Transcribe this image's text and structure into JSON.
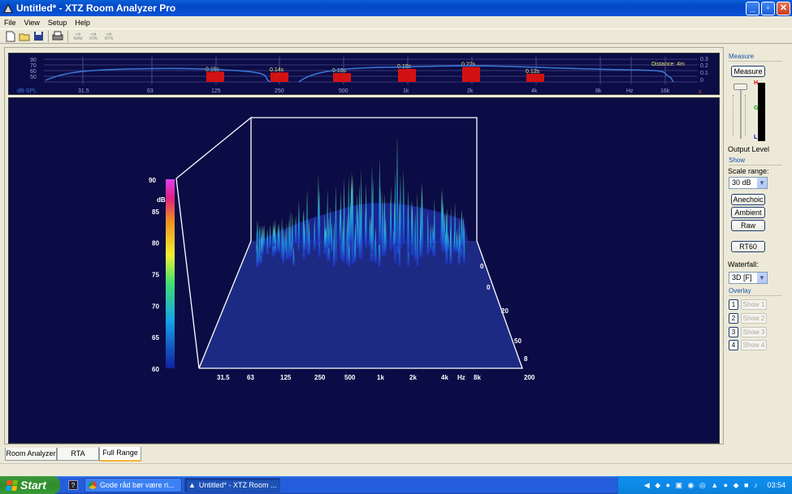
{
  "window": {
    "title": "Untitled* - XTZ Room Analyzer Pro"
  },
  "menu": [
    "File",
    "View",
    "Setup",
    "Help"
  ],
  "toolbar": {
    "ram": "RAM",
    "rta": "RTA",
    "rtn": "RTN"
  },
  "top_graph": {
    "db_ticks": [
      "90",
      "70",
      "60",
      "50"
    ],
    "rt_ticks": [
      "0.3",
      "0.2",
      "0.1",
      "0"
    ],
    "unit_label": "dB-SPL",
    "freq_labels": [
      "31.5",
      "63",
      "125",
      "250",
      "500",
      "1k",
      "2k",
      "4k",
      "8k",
      "Hz",
      "16k"
    ],
    "distance_label": "Distance: 4m",
    "end_marker": "s"
  },
  "chart_data": [
    {
      "type": "bar",
      "title": "",
      "xlabel": "Hz",
      "categories": [
        "125",
        "250",
        "500",
        "1k",
        "2k",
        "4k"
      ],
      "series": [
        {
          "values": [
            0.15,
            0.14,
            0.13,
            0.19,
            0.22,
            0.12
          ]
        }
      ],
      "data_labels": [
        "0.15s",
        "0.14s",
        "0.13s",
        "0.19s",
        "0.22s",
        "0.12s"
      ],
      "ylabel": "s",
      "ylim": [
        0,
        0.3
      ]
    },
    {
      "type": "waterfall-3d",
      "xlabel": "Hz",
      "x_ticks": [
        "31.5",
        "63",
        "125",
        "250",
        "500",
        "1k",
        "2k",
        "4k",
        "Hz",
        "8k",
        "200"
      ],
      "z_ticks": [
        "0",
        "0",
        "20",
        "50",
        "8"
      ],
      "color_scale": {
        "unit": "dB",
        "ticks": [
          "90",
          "85",
          "80",
          "75",
          "70",
          "65",
          "60"
        ],
        "range": [
          60,
          90
        ]
      }
    }
  ],
  "panel": {
    "measure_group": "Measure",
    "measure_button": "Measure",
    "meter_labels": {
      "high": "H",
      "good": "G",
      "low": "L"
    },
    "output_level": "Output Level",
    "show_group": "Show",
    "scale_range_label": "Scale range:",
    "scale_range_value": "30 dB",
    "anechoic": "Anechoic",
    "ambient": "Ambient",
    "raw": "Raw",
    "rt60": "RT60",
    "waterfall_label": "Waterfall:",
    "waterfall_value": "3D [F]",
    "overlay_group": "Overlay",
    "overlays": [
      {
        "num": "1",
        "label": "Show 1"
      },
      {
        "num": "2",
        "label": "Show 2"
      },
      {
        "num": "3",
        "label": "Show 3"
      },
      {
        "num": "4",
        "label": "Show 4"
      }
    ]
  },
  "tabs": [
    "Room Analyzer",
    "RTA",
    "Full Range"
  ],
  "taskbar": {
    "start": "Start",
    "help_icon": "?",
    "tasks": [
      "Gode råd bør være ri...",
      "Untitled* - XTZ Room ..."
    ],
    "clock": "03:54"
  }
}
